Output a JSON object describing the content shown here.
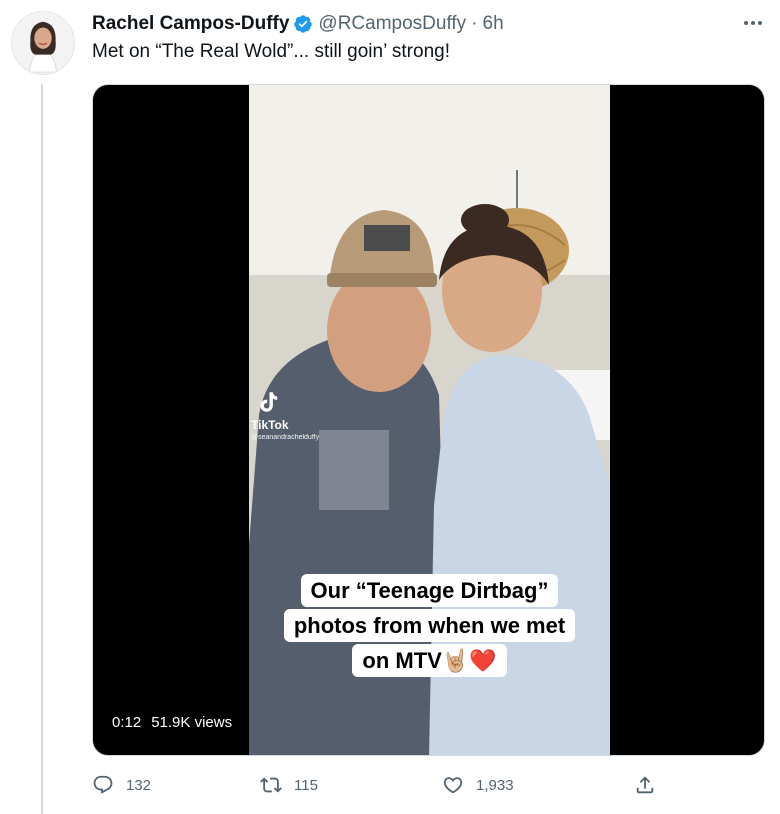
{
  "tweet": {
    "author": {
      "display_name": "Rachel Campos-Duffy",
      "handle": "@RCamposDuffy",
      "verified": true,
      "verified_icon": "verified-badge-icon"
    },
    "separator": "·",
    "time": "6h",
    "text": "Met on “The Real Wold”... still goin’ strong!",
    "more_icon": "more-options-icon"
  },
  "media": {
    "watermark": {
      "brand": "TikTok",
      "user": "@seanandrachelduffy",
      "icon": "tiktok-logo-icon"
    },
    "caption_lines": [
      "Our “Teenage Dirtbag”",
      "photos from when we met",
      "on MTV🤘🏼❤️"
    ],
    "duration": "0:12",
    "views": "51.9K views"
  },
  "actions": {
    "reply": {
      "icon": "reply-icon",
      "count": "132"
    },
    "retweet": {
      "icon": "retweet-icon",
      "count": "115"
    },
    "like": {
      "icon": "heart-icon",
      "count": "1,933"
    },
    "share": {
      "icon": "share-icon"
    }
  },
  "colors": {
    "text_primary": "#0f1419",
    "text_secondary": "#536471",
    "verified_blue": "#1d9bf0",
    "thread_line": "#cfd9de"
  }
}
